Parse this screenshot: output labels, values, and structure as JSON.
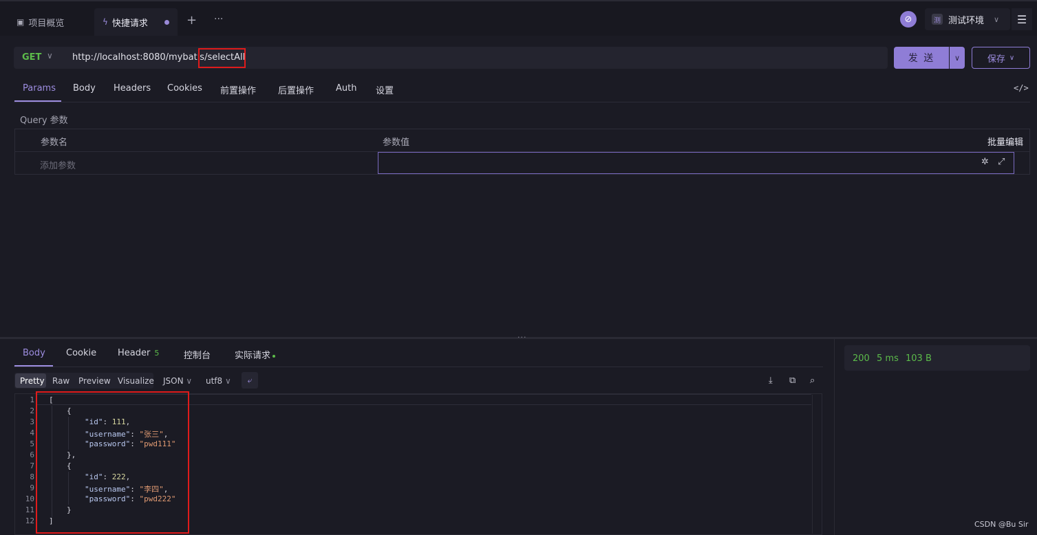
{
  "tabbar": {
    "tabs": [
      {
        "label": "项目概览",
        "icon": "overview-icon"
      },
      {
        "label": "快捷请求",
        "icon": "lightning-icon",
        "active": true,
        "unsaved": true
      }
    ],
    "add_label": "+",
    "more_label": "···"
  },
  "env": {
    "avatar_label": "⊘",
    "icon_text": "测",
    "name": "测试环境"
  },
  "request": {
    "method": "GET",
    "url": "http://localhost:8080/mybatis/selectAll",
    "send_label": "发 送",
    "save_label": "保存"
  },
  "request_tabs": [
    "Params",
    "Body",
    "Headers",
    "Cookies",
    "前置操作",
    "后置操作",
    "Auth",
    "设置"
  ],
  "params": {
    "section_title": "Query 参数",
    "col_name": "参数名",
    "col_value": "参数值",
    "bulk_edit": "批量编辑",
    "add_placeholder": "添加参数"
  },
  "response_tabs": {
    "body": "Body",
    "cookie": "Cookie",
    "header": "Header",
    "header_count": "5",
    "console": "控制台",
    "actual": "实际请求"
  },
  "format": {
    "modes": [
      "Pretty",
      "Raw",
      "Preview",
      "Visualize"
    ],
    "type": "JSON",
    "encoding": "utf8"
  },
  "status": {
    "code": "200",
    "time": "5 ms",
    "size": "103 B"
  },
  "response_lines": [
    "1",
    "2",
    "3",
    "4",
    "5",
    "6",
    "7",
    "8",
    "9",
    "10",
    "11",
    "12"
  ],
  "response_body": {
    "open_array": "[",
    "open_obj": "{",
    "close_obj_comma": "},",
    "close_obj": "}",
    "close_array": "]",
    "items": [
      {
        "id_key": "\"id\"",
        "id_val": "111",
        "user_key": "\"username\"",
        "user_val": "\"张三\"",
        "pwd_key": "\"password\"",
        "pwd_val": "\"pwd111\""
      },
      {
        "id_key": "\"id\"",
        "id_val": "222",
        "user_key": "\"username\"",
        "user_val": "\"李四\"",
        "pwd_key": "\"password\"",
        "pwd_val": "\"pwd222\""
      }
    ]
  },
  "watermark": "CSDN @Bu Sir",
  "colors": {
    "accent": "#8f7dd6",
    "success": "#5cbb4a",
    "highlight": "#e01b1b"
  }
}
